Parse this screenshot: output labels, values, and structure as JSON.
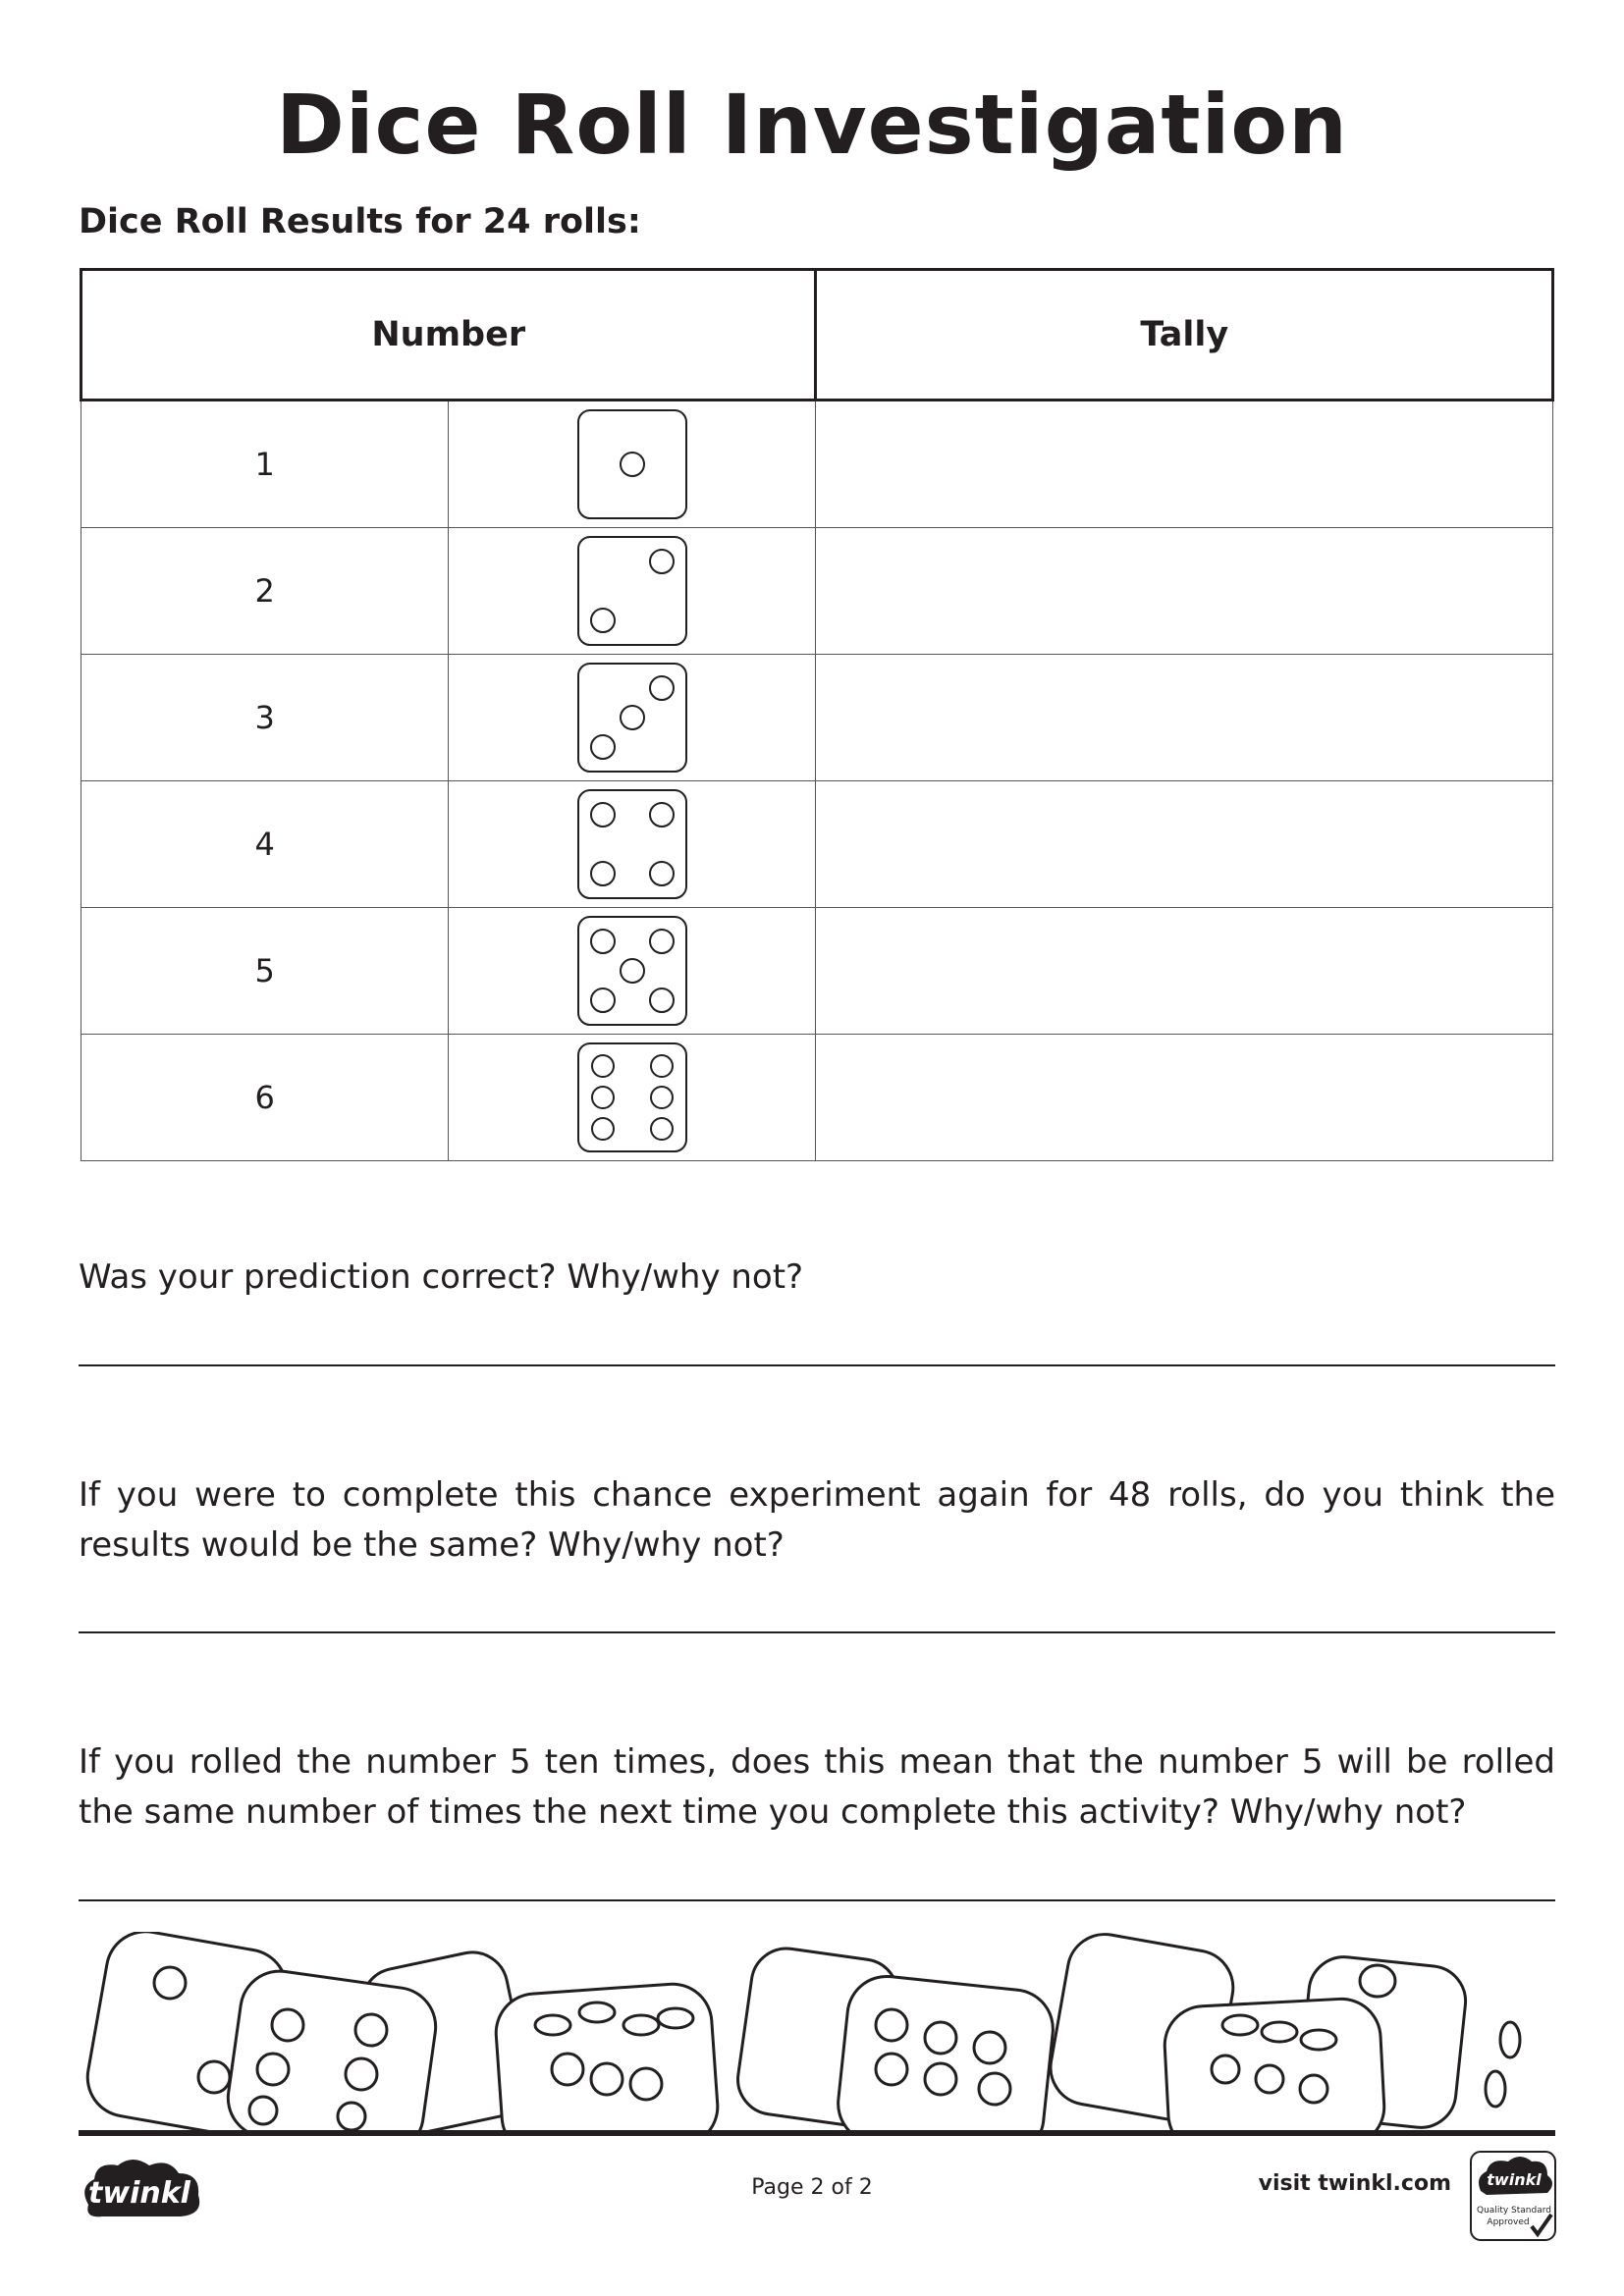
{
  "title": "Dice Roll Investigation",
  "subtitle": "Dice Roll Results for 24 rolls:",
  "table": {
    "headers": {
      "number": "Number",
      "tally": "Tally"
    },
    "rows": [
      {
        "number": "1",
        "tally": ""
      },
      {
        "number": "2",
        "tally": ""
      },
      {
        "number": "3",
        "tally": ""
      },
      {
        "number": "4",
        "tally": ""
      },
      {
        "number": "5",
        "tally": ""
      },
      {
        "number": "6",
        "tally": ""
      }
    ]
  },
  "questions": [
    {
      "text": "Was your prediction correct? Why/why not?",
      "answer": ""
    },
    {
      "text": "If you were to complete this chance experiment again for 48 rolls, do you think the results would be the same? Why/why not?",
      "answer": ""
    },
    {
      "text": "If you rolled the number 5 ten times, does this mean that the number 5 will be rolled the same number of times the next time you complete this activity? Why/why not?",
      "answer": ""
    }
  ],
  "footer": {
    "logo_text": "twinkl",
    "page": "Page 2 of 2",
    "visit": "visit twinkl.com",
    "badge": {
      "brand": "twinkl",
      "line1": "Quality Standard",
      "line2": "Approved"
    }
  }
}
